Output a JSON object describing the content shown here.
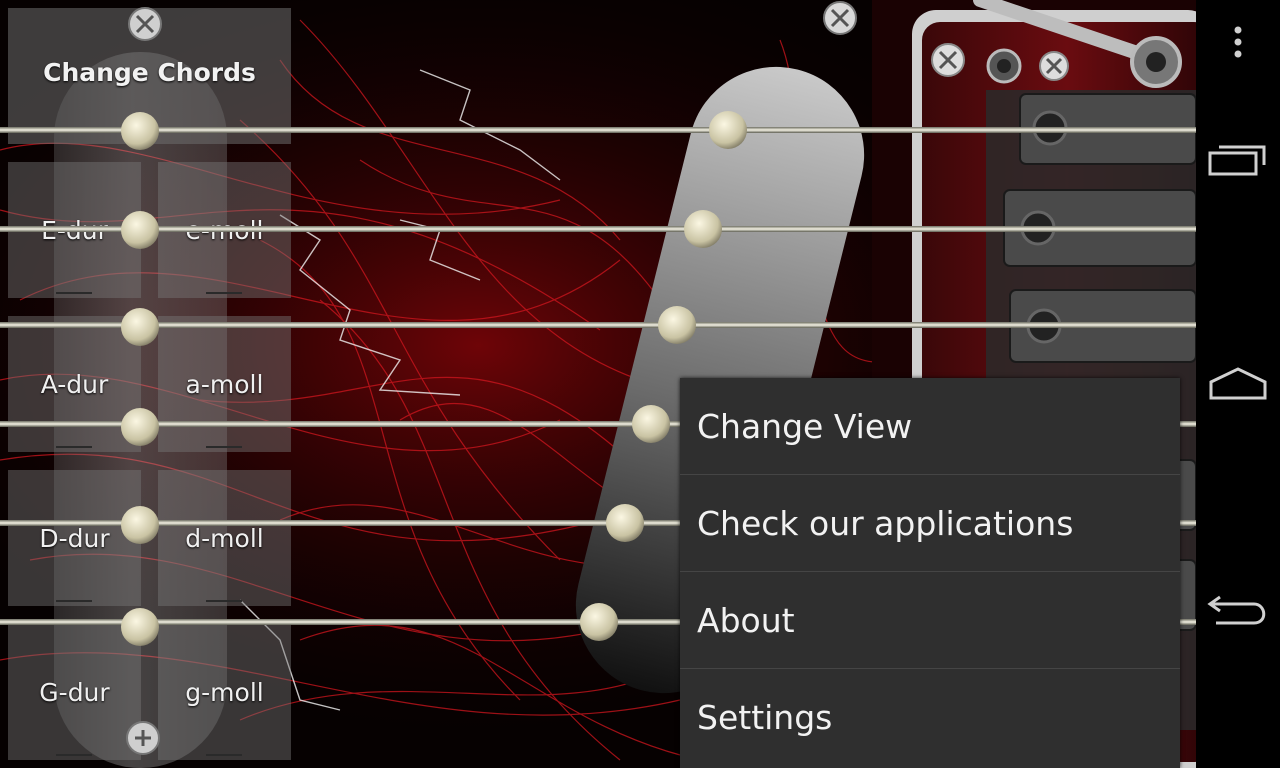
{
  "chord_panel": {
    "change_chords_label": "Change Chords",
    "chords": [
      {
        "major": "E-dur",
        "minor": "e-moll"
      },
      {
        "major": "A-dur",
        "minor": "a-moll"
      },
      {
        "major": "D-dur",
        "minor": "d-moll"
      },
      {
        "major": "G-dur",
        "minor": "g-moll"
      }
    ]
  },
  "overflow_menu": {
    "items": [
      {
        "label": "Change View"
      },
      {
        "label": "Check our applications"
      },
      {
        "label": "About"
      },
      {
        "label": "Settings"
      }
    ]
  },
  "guitar": {
    "string_count": 6,
    "accent_color": "#c8121a",
    "body_color": "#050101"
  },
  "navigation_bar": {
    "icons": [
      "more-options-icon",
      "recent-apps-icon",
      "home-icon",
      "back-icon"
    ]
  }
}
